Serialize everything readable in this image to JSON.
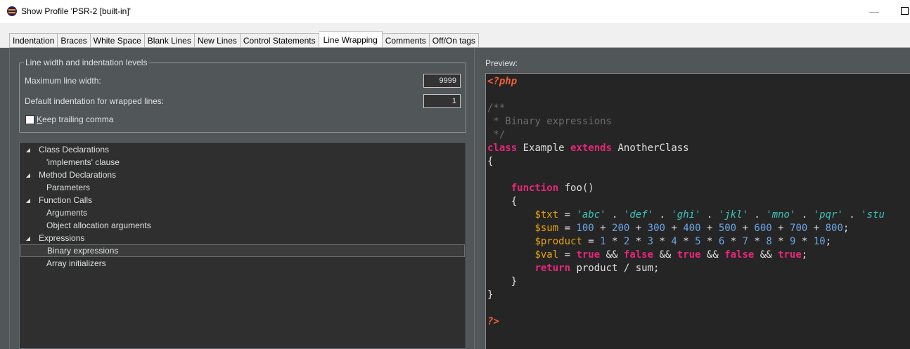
{
  "window": {
    "title": "Show Profile 'PSR-2 [built-in]'"
  },
  "tabs": [
    {
      "label": "Indentation"
    },
    {
      "label": "Braces"
    },
    {
      "label": "White Space"
    },
    {
      "label": "Blank Lines"
    },
    {
      "label": "New Lines"
    },
    {
      "label": "Control Statements"
    },
    {
      "label": "Line Wrapping",
      "active": true
    },
    {
      "label": "Comments"
    },
    {
      "label": "Off/On tags"
    }
  ],
  "settings": {
    "group_title": "Line width and indentation levels",
    "max_width_label": "Maximum line width:",
    "max_width_value": "9999",
    "indent_label": "Default indentation for wrapped lines:",
    "indent_value": "1",
    "trailing_comma_prefix": "K",
    "trailing_comma_rest": "eep trailing comma",
    "trailing_comma_checked": false
  },
  "tree": [
    {
      "label": "Class Declarations",
      "expandable": true
    },
    {
      "label": "'implements' clause"
    },
    {
      "label": "Method Declarations",
      "expandable": true
    },
    {
      "label": "Parameters"
    },
    {
      "label": "Function Calls",
      "expandable": true
    },
    {
      "label": "Arguments"
    },
    {
      "label": "Object allocation arguments"
    },
    {
      "label": "Expressions",
      "expandable": true
    },
    {
      "label": "Binary expressions",
      "selected": true
    },
    {
      "label": "Array initializers"
    }
  ],
  "preview": {
    "label": "Preview:",
    "code": [
      [
        [
          "php",
          "<?php"
        ]
      ],
      [],
      [
        [
          "comment",
          "/**"
        ]
      ],
      [
        [
          "comment",
          " * Binary expressions"
        ]
      ],
      [
        [
          "comment",
          " */"
        ]
      ],
      [
        [
          "kw",
          "class"
        ],
        [
          "plain",
          " Example "
        ],
        [
          "kw",
          "extends"
        ],
        [
          "plain",
          " AnotherClass"
        ]
      ],
      [
        [
          "plain",
          "{"
        ]
      ],
      [],
      [
        [
          "plain",
          "    "
        ],
        [
          "kw",
          "function"
        ],
        [
          "plain",
          " foo()"
        ]
      ],
      [
        [
          "plain",
          "    {"
        ]
      ],
      [
        [
          "plain",
          "        "
        ],
        [
          "var",
          "$txt"
        ],
        [
          "plain",
          " = "
        ],
        [
          "str",
          "'abc'"
        ],
        [
          "plain",
          " . "
        ],
        [
          "str",
          "'def'"
        ],
        [
          "plain",
          " . "
        ],
        [
          "str",
          "'ghi'"
        ],
        [
          "plain",
          " . "
        ],
        [
          "str",
          "'jkl'"
        ],
        [
          "plain",
          " . "
        ],
        [
          "str",
          "'mno'"
        ],
        [
          "plain",
          " . "
        ],
        [
          "str",
          "'pqr'"
        ],
        [
          "plain",
          " . "
        ],
        [
          "str",
          "'stu"
        ]
      ],
      [
        [
          "plain",
          "        "
        ],
        [
          "var",
          "$sum"
        ],
        [
          "plain",
          " = "
        ],
        [
          "num",
          "100"
        ],
        [
          "plain",
          " + "
        ],
        [
          "num",
          "200"
        ],
        [
          "plain",
          " + "
        ],
        [
          "num",
          "300"
        ],
        [
          "plain",
          " + "
        ],
        [
          "num",
          "400"
        ],
        [
          "plain",
          " + "
        ],
        [
          "num",
          "500"
        ],
        [
          "plain",
          " + "
        ],
        [
          "num",
          "600"
        ],
        [
          "plain",
          " + "
        ],
        [
          "num",
          "700"
        ],
        [
          "plain",
          " + "
        ],
        [
          "num",
          "800"
        ],
        [
          "plain",
          ";"
        ]
      ],
      [
        [
          "plain",
          "        "
        ],
        [
          "var",
          "$product"
        ],
        [
          "plain",
          " = "
        ],
        [
          "num",
          "1"
        ],
        [
          "plain",
          " * "
        ],
        [
          "num",
          "2"
        ],
        [
          "plain",
          " * "
        ],
        [
          "num",
          "3"
        ],
        [
          "plain",
          " * "
        ],
        [
          "num",
          "4"
        ],
        [
          "plain",
          " * "
        ],
        [
          "num",
          "5"
        ],
        [
          "plain",
          " * "
        ],
        [
          "num",
          "6"
        ],
        [
          "plain",
          " * "
        ],
        [
          "num",
          "7"
        ],
        [
          "plain",
          " * "
        ],
        [
          "num",
          "8"
        ],
        [
          "plain",
          " * "
        ],
        [
          "num",
          "9"
        ],
        [
          "plain",
          " * "
        ],
        [
          "num",
          "10"
        ],
        [
          "plain",
          ";"
        ]
      ],
      [
        [
          "plain",
          "        "
        ],
        [
          "var",
          "$val"
        ],
        [
          "plain",
          " = "
        ],
        [
          "kw",
          "true"
        ],
        [
          "plain",
          " && "
        ],
        [
          "kw",
          "false"
        ],
        [
          "plain",
          " && "
        ],
        [
          "kw",
          "true"
        ],
        [
          "plain",
          " && "
        ],
        [
          "kw",
          "false"
        ],
        [
          "plain",
          " && "
        ],
        [
          "kw",
          "true"
        ],
        [
          "plain",
          ";"
        ]
      ],
      [
        [
          "plain",
          "        "
        ],
        [
          "kw",
          "return"
        ],
        [
          "plain",
          " product / sum;"
        ]
      ],
      [
        [
          "plain",
          "    }"
        ]
      ],
      [
        [
          "plain",
          "}"
        ]
      ],
      [],
      [
        [
          "php",
          "?>"
        ]
      ]
    ]
  },
  "colors": {
    "keyword": "#e6267a",
    "variable": "#e8a30d",
    "string": "#3ec2b8",
    "number": "#6aa5e6",
    "comment": "#6c6c6c",
    "php_tag": "#f05e39"
  }
}
